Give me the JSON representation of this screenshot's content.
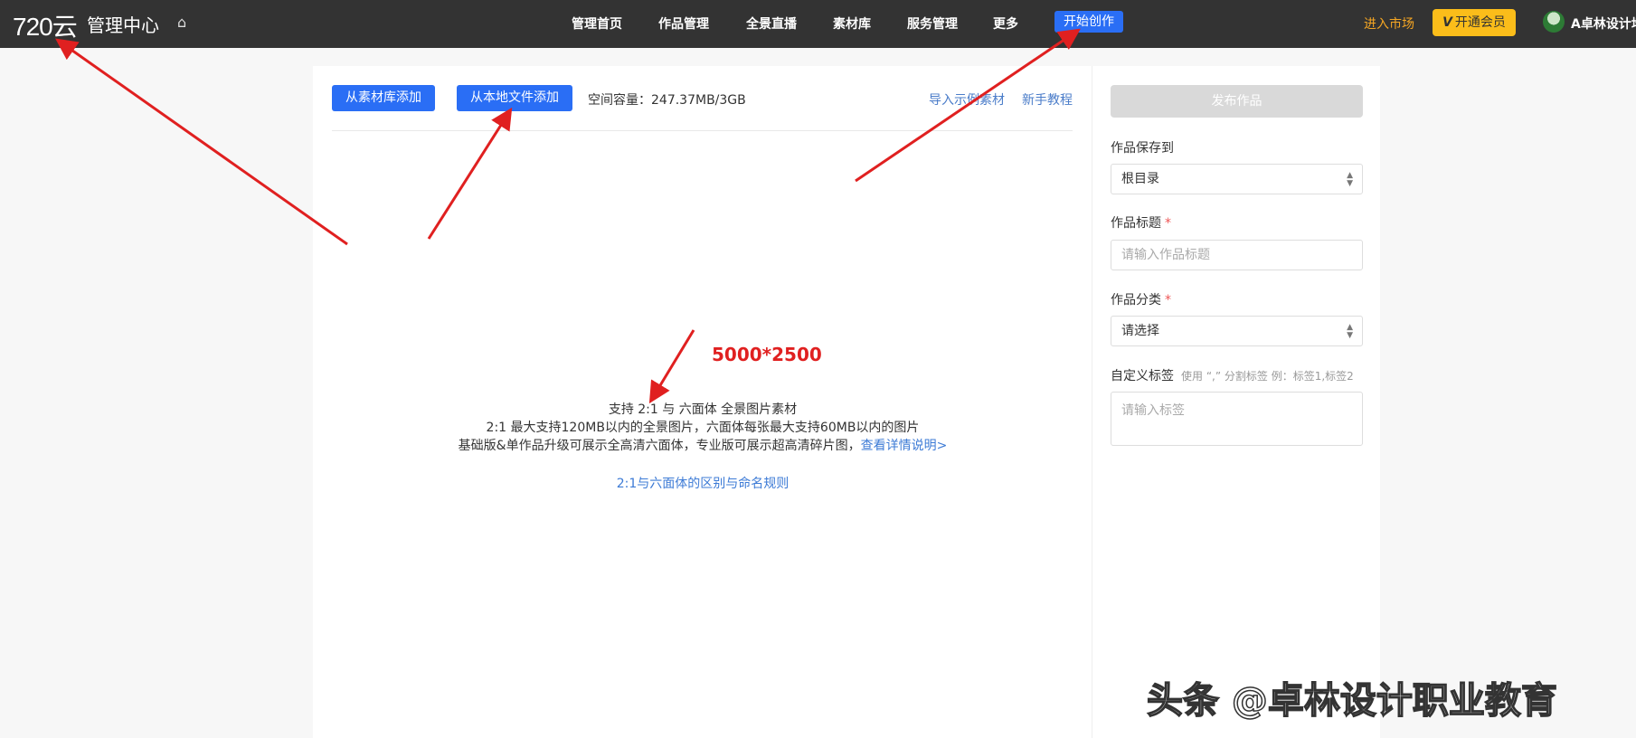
{
  "header": {
    "logo": "720云",
    "title": "管理中心",
    "home_icon": "home-icon",
    "nav": [
      "管理首页",
      "作品管理",
      "全景直播",
      "素材库",
      "服务管理",
      "更多"
    ],
    "start_button": "开始创作",
    "market": "进入市场",
    "vip_icon": "V",
    "vip_button": "开通会员",
    "user_name": "A卓林设计培"
  },
  "toolbar": {
    "add_from_library": "从素材库添加",
    "add_from_local": "从本地文件添加",
    "capacity": "空间容量：247.37MB/3GB",
    "import_sample": "导入示例素材",
    "tutorial": "新手教程"
  },
  "center": {
    "line1": "支持 2:1 与 六面体 全景图片素材",
    "line2": "2:1 最大支持120MB以内的全景图片，六面体每张最大支持60MB以内的图片",
    "line3": "基础版&单作品升级可展示全高清六面体，专业版可展示超高清碎片图，",
    "details_link": "查看详情说明>",
    "rules_link": "2:1与六面体的区别与命名规则"
  },
  "annotation": {
    "size_text": "5000*2500",
    "arrow_color": "#e02020"
  },
  "side": {
    "publish_button": "发布作品",
    "save_to_label": "作品保存到",
    "save_to_value": "根目录",
    "title_label": "作品标题",
    "title_placeholder": "请输入作品标题",
    "category_label": "作品分类",
    "category_value": "请选择",
    "required_mark": "*",
    "tags_label": "自定义标签",
    "tags_hint": "使用 “,” 分割标签 例：标签1,标签2",
    "tags_placeholder": "请输入标签"
  },
  "watermark": "头条 @卓林设计职业教育",
  "colors": {
    "header_bg": "#333333",
    "primary": "#2a6ef5",
    "vip": "#fbbd1a",
    "market": "#f5a623"
  }
}
